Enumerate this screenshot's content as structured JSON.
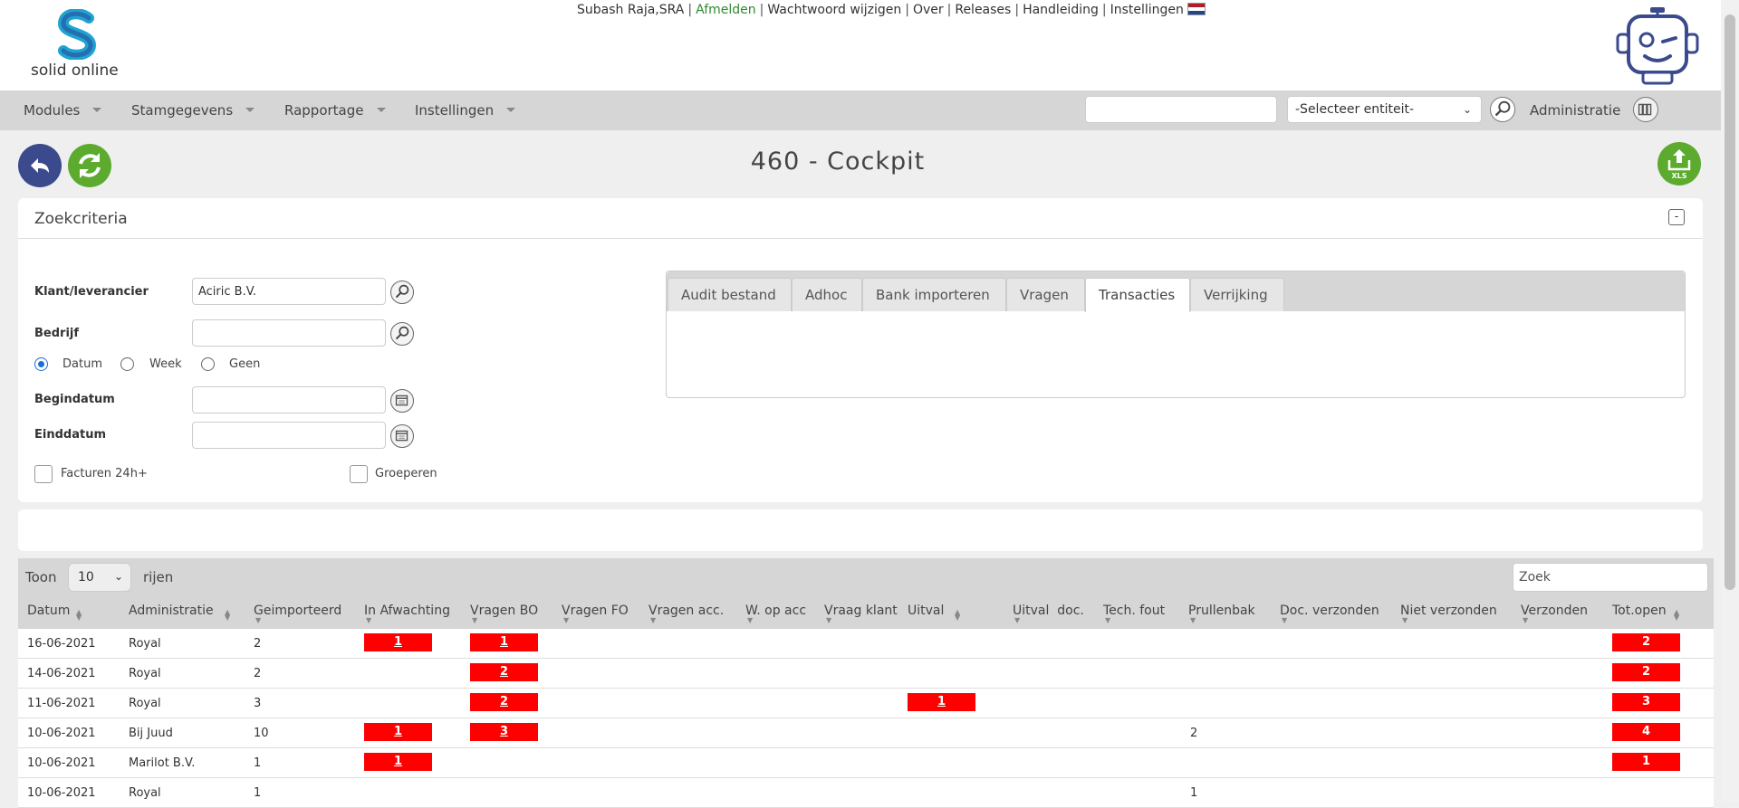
{
  "header": {
    "logo_text": "solid online",
    "user": "Subash Raja,SRA",
    "links": [
      "Afmelden",
      "Wachtwoord wijzigen",
      "Over",
      "Releases",
      "Handleiding",
      "Instellingen"
    ]
  },
  "nav": {
    "items": [
      "Modules",
      "Stamgegevens",
      "Rapportage",
      "Instellingen"
    ],
    "search_value": "",
    "entity_select": "-Selecteer entiteit-",
    "admin_label": "Administratie"
  },
  "page": {
    "title": "460 - Cockpit"
  },
  "search_panel": {
    "title": "Zoekcriteria",
    "collapse_symbol": "-",
    "fields": {
      "klant_label": "Klant/leverancier",
      "klant_value": "Aciric B.V.",
      "bedrijf_label": "Bedrijf",
      "bedrijf_value": "",
      "begindatum_label": "Begindatum",
      "einddatum_label": "Einddatum"
    },
    "radios": [
      {
        "label": "Datum",
        "checked": true
      },
      {
        "label": "Week",
        "checked": false
      },
      {
        "label": "Geen",
        "checked": false
      }
    ],
    "checkboxes": [
      {
        "label": "Facturen 24h+",
        "checked": false
      },
      {
        "label": "Groeperen",
        "checked": false
      }
    ],
    "tabs": [
      "Audit bestand",
      "Adhoc",
      "Bank importeren",
      "Vragen",
      "Transacties",
      "Verrijking"
    ],
    "active_tab": "Transacties"
  },
  "table": {
    "toon_label": "Toon",
    "page_length": "10",
    "rows_label": "rijen",
    "search_placeholder": "Zoek",
    "columns": [
      "Datum",
      "Administratie",
      "Geimporteerd",
      "In Afwachting",
      "Vragen BO",
      "Vragen FO",
      "Vragen acc.",
      "W. op acc",
      "Vraag klant",
      "Uitval",
      "Uitval  doc.",
      "Tech. fout",
      "Prullenbak",
      "Doc. verzonden",
      "Niet verzonden",
      "Verzonden",
      "Tot.open"
    ],
    "rows": [
      {
        "datum": "16-06-2021",
        "administratie": "Royal",
        "geimporteerd": "2",
        "in_afwachting": "1",
        "vragen_bo": "1",
        "uitval": "",
        "prullenbak": "",
        "tot_open": "2"
      },
      {
        "datum": "14-06-2021",
        "administratie": "Royal",
        "geimporteerd": "2",
        "in_afwachting": "",
        "vragen_bo": "2",
        "uitval": "",
        "prullenbak": "",
        "tot_open": "2"
      },
      {
        "datum": "11-06-2021",
        "administratie": "Royal",
        "geimporteerd": "3",
        "in_afwachting": "",
        "vragen_bo": "2",
        "uitval": "1",
        "prullenbak": "",
        "tot_open": "3"
      },
      {
        "datum": "10-06-2021",
        "administratie": "Bij Juud",
        "geimporteerd": "10",
        "in_afwachting": "1",
        "vragen_bo": "3",
        "uitval": "",
        "prullenbak": "2",
        "tot_open": "4"
      },
      {
        "datum": "10-06-2021",
        "administratie": "Marilot B.V.",
        "geimporteerd": "1",
        "in_afwachting": "1",
        "vragen_bo": "",
        "uitval": "",
        "prullenbak": "",
        "tot_open": "1"
      },
      {
        "datum": "10-06-2021",
        "administratie": "Royal",
        "geimporteerd": "1",
        "in_afwachting": "",
        "vragen_bo": "",
        "uitval": "",
        "prullenbak": "1",
        "tot_open": ""
      }
    ]
  },
  "colors": {
    "badge_red": "#ff0000",
    "nav_grey": "#d6d6d6",
    "back_button": "#3a4a8c",
    "refresh_button": "#5cab2e",
    "afmelden_green": "#2e8b2e"
  },
  "icons": [
    "back-arrow-icon",
    "refresh-icon",
    "xls-export-icon",
    "magnifier-icon",
    "calendar-icon",
    "binder-icon",
    "robot-icon",
    "flag-nl-icon"
  ]
}
